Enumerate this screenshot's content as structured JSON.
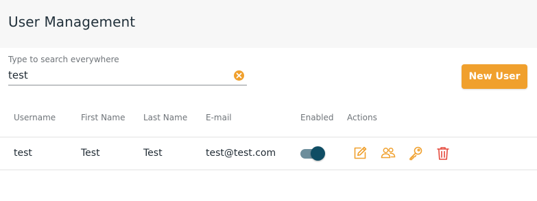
{
  "header": {
    "title": "User Management"
  },
  "search": {
    "label": "Type to search everywhere",
    "value": "test",
    "clear_icon": "clear-circle-icon"
  },
  "toolbar": {
    "new_user_label": "New User"
  },
  "colors": {
    "accent": "#f0a02d",
    "danger": "#e5483b",
    "toggle_on": "#0f4d64"
  },
  "table": {
    "columns": [
      "Username",
      "First Name",
      "Last Name",
      "E-mail",
      "Enabled",
      "Actions"
    ],
    "rows": [
      {
        "username": "test",
        "first_name": "Test",
        "last_name": "Test",
        "email": "test@test.com",
        "enabled": true,
        "actions": [
          "edit-icon",
          "users-icon",
          "key-icon",
          "trash-icon"
        ]
      }
    ]
  }
}
